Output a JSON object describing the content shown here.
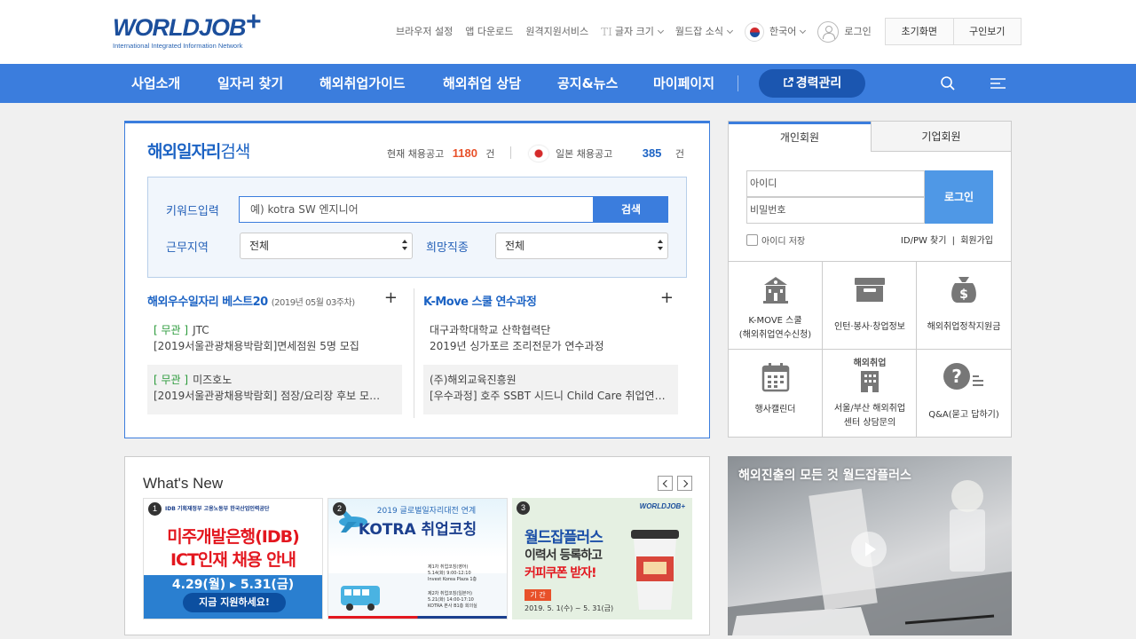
{
  "header": {
    "logo_word": "WORLDJOB",
    "logo_plus": "+",
    "logo_sub": "International Integrated Information Network",
    "utils": {
      "browser": "브라우저 설정",
      "app": "앱 다운로드",
      "remote": "원격지원서비스",
      "font_icon": "TI",
      "font": "글자 크기",
      "news": "월드잡 소식",
      "lang": "한국어",
      "login": "로그인"
    },
    "btn_home": "초기화면",
    "btn_recruit": "구인보기"
  },
  "nav": {
    "items": [
      "사업소개",
      "일자리 찾기",
      "해외취업가이드",
      "해외취업 상담",
      "공지&뉴스",
      "마이페이지"
    ],
    "career": "경력관리"
  },
  "search_panel": {
    "title_bold": "해외일자리",
    "title_rest": "검색",
    "current_label": "현재 채용공고",
    "current_count": "1180",
    "unit": "건",
    "japan_label": "일본 채용공고",
    "japan_count": "385",
    "keyword_label": "키워드입력",
    "keyword_placeholder": "예) kotra SW 엔지니어",
    "search_btn": "검색",
    "region_label": "근무지역",
    "region_value": "전체",
    "job_label": "희망직종",
    "job_value": "전체"
  },
  "best20": {
    "title": "해외우수일자리 베스트20",
    "week": "(2019년 05월 03주차)",
    "plus": "+",
    "items": [
      {
        "tag": "[ 무관 ]",
        "company": "JTC",
        "desc": "[2019서울관광채용박람회]면세점원 5명 모집"
      },
      {
        "tag": "[ 무관 ]",
        "company": "미즈호노",
        "desc": "[2019서울관광채용박람회] 점장/요리장 후보 모…"
      }
    ]
  },
  "kmove": {
    "title": "K-Move 스쿨 연수과정",
    "plus": "+",
    "items": [
      {
        "org": "대구과학대학교 산학협력단",
        "desc": "2019년 싱가포르 조리전문가 연수과정"
      },
      {
        "org": "(주)해외교육진흥원",
        "desc": "[우수과정] 호주 SSBT 시드니 Child Care 취업연…"
      }
    ]
  },
  "login": {
    "tab_personal": "개인회원",
    "tab_company": "기업회원",
    "id_placeholder": "아이디",
    "pw_placeholder": "비밀번호",
    "login_btn": "로그인",
    "save_id": "아이디 저장",
    "find": "ID/PW 찾기",
    "join": "회원가입",
    "menu": [
      {
        "icon": "school-icon",
        "label1": "K-MOVE 스쿨",
        "label2": "(해외취업연수신청)"
      },
      {
        "icon": "box-icon",
        "label1": "인턴·봉사·창업정보",
        "label2": ""
      },
      {
        "icon": "money-bag-icon",
        "label1": "해외취업정착지원금",
        "label2": ""
      },
      {
        "icon": "calendar-icon",
        "label1": "행사캘린더",
        "label2": ""
      },
      {
        "icon": "building-icon",
        "label0": "해외취업",
        "label1": "서울/부산 해외취업",
        "label2": "센터 상담문의"
      },
      {
        "icon": "question-icon",
        "label1": "Q&A(묻고 답하기)",
        "label2": ""
      }
    ]
  },
  "whats_new": {
    "title": "What's New",
    "cards": [
      {
        "no": "1",
        "top": "IDB  기획재정부  고용노동부  한국산업인력공단",
        "line1": "미주개발은행(IDB)",
        "line2": "ICT인재 채용 안내",
        "date": "4.29(월) ▸ 5.31(금)",
        "cta": "지금 지원하세요!"
      },
      {
        "no": "2",
        "line0": "2019 글로벌일자리대전 연계",
        "line1": "KOTRA 취업코칭",
        "s1": "제1차 취업코칭(영어)",
        "s1d": "5.14(화) 9:00-12:10",
        "s1p": "Invest Korea Plaza 1층",
        "s2": "제2차 취업코칭(일본어)",
        "s2d": "5.21(화) 14:00-17:10",
        "s2p": "KOTRA 본사 B1층 회의실"
      },
      {
        "no": "3",
        "brand": "WORLDJOB+",
        "line1": "월드잡플러스",
        "line2": "이력서 등록하고",
        "line3": "커피쿠폰 받자!",
        "period_label": "기 간",
        "period": "2019. 5. 1(수) ~ 5. 31(금)"
      }
    ]
  },
  "video": {
    "title": "해외진출의 모든 것 월드잡플러스"
  },
  "colors": {
    "brand": "#3b7ddd",
    "accent_orange": "#e8512a",
    "count_blue": "#1c63c4",
    "tag_green": "#2a9a3a"
  }
}
